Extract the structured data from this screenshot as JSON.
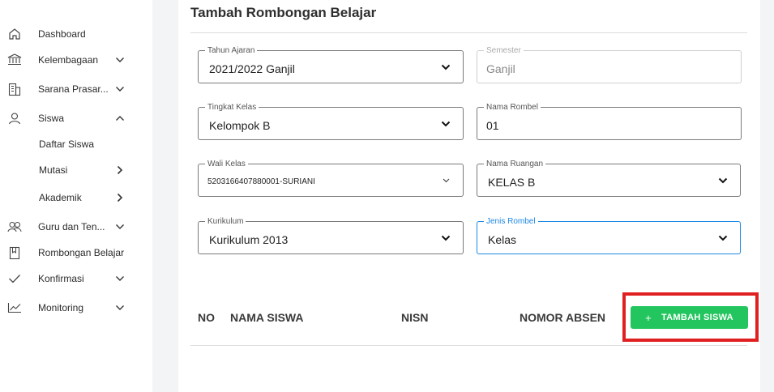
{
  "sidebar": {
    "items": [
      {
        "label": "Dashboard",
        "icon": "home-icon"
      },
      {
        "label": "Kelembagaan",
        "icon": "bank-icon",
        "chevron": "down"
      },
      {
        "label": "Sarana Prasar...",
        "icon": "building-icon",
        "chevron": "down"
      },
      {
        "label": "Siswa",
        "icon": "user-icon",
        "chevron": "up"
      },
      {
        "label": "Daftar Siswa"
      },
      {
        "label": "Mutasi",
        "chevron": "right"
      },
      {
        "label": "Akademik",
        "chevron": "right"
      },
      {
        "label": "Guru dan Ten...",
        "icon": "users-icon",
        "chevron": "down"
      },
      {
        "label": "Rombongan Belajar",
        "icon": "book-icon"
      },
      {
        "label": "Konfirmasi",
        "icon": "check-icon",
        "chevron": "down"
      },
      {
        "label": "Monitoring",
        "icon": "chart-icon",
        "chevron": "down"
      }
    ]
  },
  "main": {
    "title": "Tambah Rombongan Belajar",
    "fields": {
      "tahun_ajaran": {
        "label": "Tahun Ajaran",
        "value": "2021/2022 Ganjil"
      },
      "semester": {
        "label": "Semester",
        "value": "Ganjil"
      },
      "tingkat_kelas": {
        "label": "Tingkat Kelas",
        "value": "Kelompok B"
      },
      "nama_rombel": {
        "label": "Nama Rombel",
        "value": "01"
      },
      "wali_kelas": {
        "label": "Wali Kelas",
        "value": "5203166407880001-SURIANI"
      },
      "nama_ruangan": {
        "label": "Nama Ruangan",
        "value": "KELAS B"
      },
      "kurikulum": {
        "label": "Kurikulum",
        "value": "Kurikulum 2013"
      },
      "jenis_rombel": {
        "label": "Jenis Rombel",
        "value": "Kelas"
      }
    },
    "table": {
      "headers": {
        "no": "NO",
        "nama": "NAMA SISWA",
        "nisn": "NISN",
        "absen": "NOMOR ABSEN"
      }
    },
    "add_button": {
      "icon": "+",
      "label": "TAMBAH SISWA"
    }
  },
  "colors": {
    "accent_green": "#22c55e",
    "focus_blue": "#1e88e5",
    "highlight_red": "#e02020"
  }
}
